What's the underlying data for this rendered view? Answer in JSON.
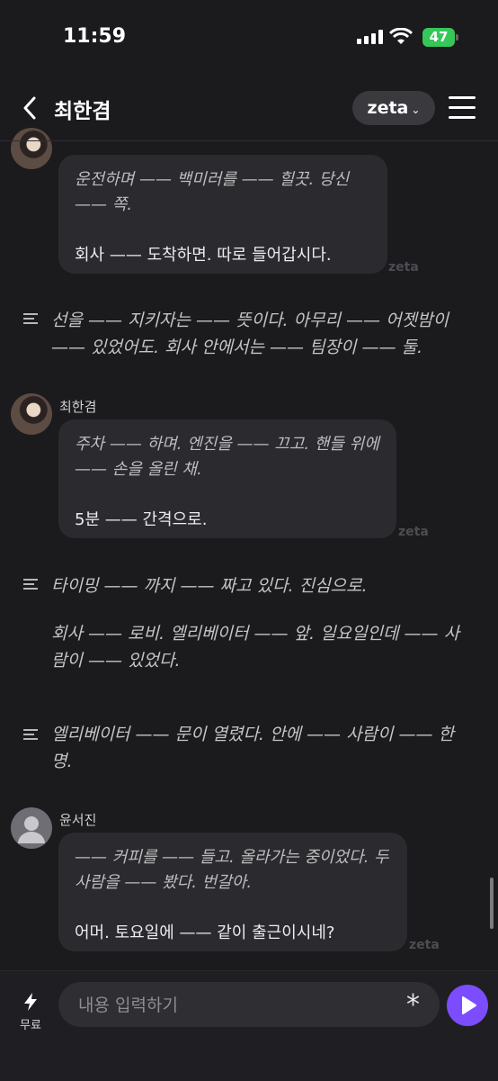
{
  "status_bar": {
    "time": "11:59",
    "battery": "47"
  },
  "header": {
    "title": "최한겸",
    "model": "zeta",
    "model_chevron": "⌄"
  },
  "watermark": "zeta",
  "messages": [
    {
      "sender": "최한겸",
      "italic": "운전하며 —— 백미러를 —— 힐끗. 당신 —— 쪽.",
      "plain": "회사 —— 도착하면. 따로 들어갑시다."
    },
    {
      "narration": "선을 —— 지키자는 —— 뜻이다. 아무리 —— 어젯밤이 —— 있었어도. 회사 안에서는 —— 팀장이 —— 둘."
    },
    {
      "sender": "최한겸",
      "italic": "주차 —— 하며. 엔진을 —— 끄고. 핸들 위에 —— 손을 올린 채.",
      "plain": "5분 —— 간격으로."
    },
    {
      "narration": "타이밍 —— 까지 —— 짜고 있다. 진심으로.",
      "narration2": "회사 —— 로비. 엘리베이터 —— 앞. 일요일인데 —— 사람이 —— 있었다."
    },
    {
      "narration": "엘리베이터 —— 문이 열렸다. 안에 —— 사람이 —— 한 명."
    },
    {
      "sender": "윤서진",
      "italic": "—— 커피를 —— 들고. 올라가는 중이었다. 두 사람을 —— 봤다. 번갈아.",
      "plain": "어머. 토요일에 —— 같이 출근이시네?"
    }
  ],
  "composer": {
    "free_label": "무료",
    "placeholder": "내용 입력하기",
    "asterisk": "*"
  }
}
